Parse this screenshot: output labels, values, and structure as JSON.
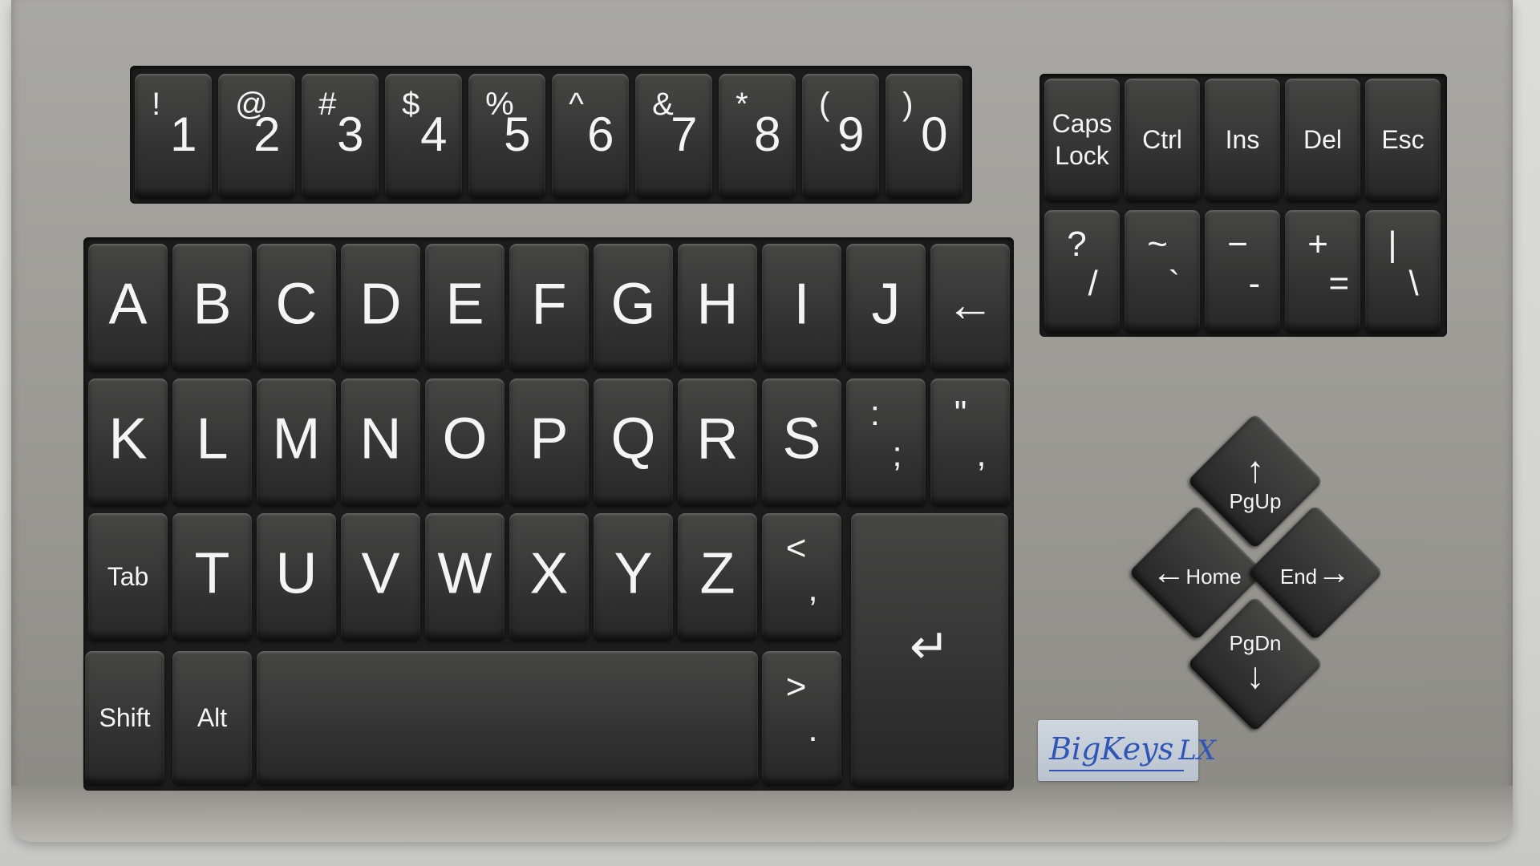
{
  "number_row": [
    {
      "shift": "!",
      "main": "1"
    },
    {
      "shift": "@",
      "main": "2"
    },
    {
      "shift": "#",
      "main": "3"
    },
    {
      "shift": "$",
      "main": "4"
    },
    {
      "shift": "%",
      "main": "5"
    },
    {
      "shift": "^",
      "main": "6"
    },
    {
      "shift": "&",
      "main": "7"
    },
    {
      "shift": "*",
      "main": "8"
    },
    {
      "shift": "(",
      "main": "9"
    },
    {
      "shift": ")",
      "main": "0"
    }
  ],
  "function_keys": [
    "Caps Lock",
    "Ctrl",
    "Ins",
    "Del",
    "Esc"
  ],
  "symbol_keys": [
    {
      "upper": "?",
      "lower": "/"
    },
    {
      "upper": "~",
      "lower": "`"
    },
    {
      "upper": "−",
      "lower": "-"
    },
    {
      "upper": "+",
      "lower": "="
    },
    {
      "upper": "|",
      "lower": "\\"
    }
  ],
  "row1": [
    "A",
    "B",
    "C",
    "D",
    "E",
    "F",
    "G",
    "H",
    "I",
    "J",
    "←"
  ],
  "row2": [
    "K",
    "L",
    "M",
    "N",
    "O",
    "P",
    "Q",
    "R",
    "S"
  ],
  "row2_pairs": [
    {
      "upper": ":",
      "lower": ";"
    },
    {
      "upper": "\"",
      "lower": ","
    }
  ],
  "row3_tab": "Tab",
  "row3": [
    "T",
    "U",
    "V",
    "W",
    "X",
    "Y",
    "Z"
  ],
  "row3_pair": {
    "upper": "<",
    "lower": ","
  },
  "row4": {
    "shift": "Shift",
    "alt": "Alt",
    "period_upper": ">",
    "period_lower": "."
  },
  "enter_symbol": "↵",
  "nav": {
    "pgup": "PgUp",
    "home": "Home",
    "end": "End",
    "pgdn": "PgDn",
    "up": "↑",
    "left": "←",
    "right": "→",
    "down": "↓"
  },
  "brand": {
    "name": "BigKeys",
    "model": "LX",
    "color": "#2f55b6"
  }
}
